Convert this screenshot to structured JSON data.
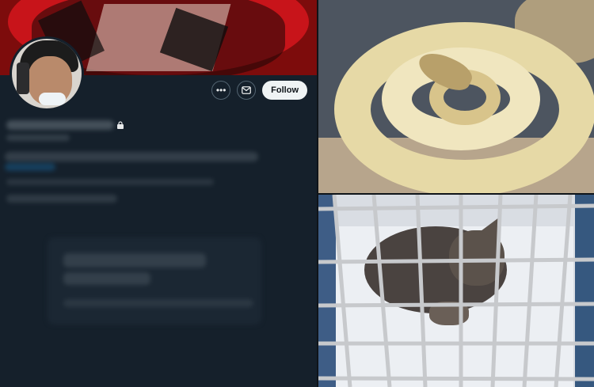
{
  "profile": {
    "follow_label": "Follow",
    "more_icon": "more-icon",
    "message_icon": "envelope-icon",
    "lock_icon": "lock-icon"
  },
  "images": {
    "top_right": "python-snake-photo",
    "bottom_right": "kitten-in-crate-photo"
  },
  "colors": {
    "background": "#15202b",
    "follow_button_bg": "#eff3f4",
    "banner_red": "#c8141a"
  }
}
